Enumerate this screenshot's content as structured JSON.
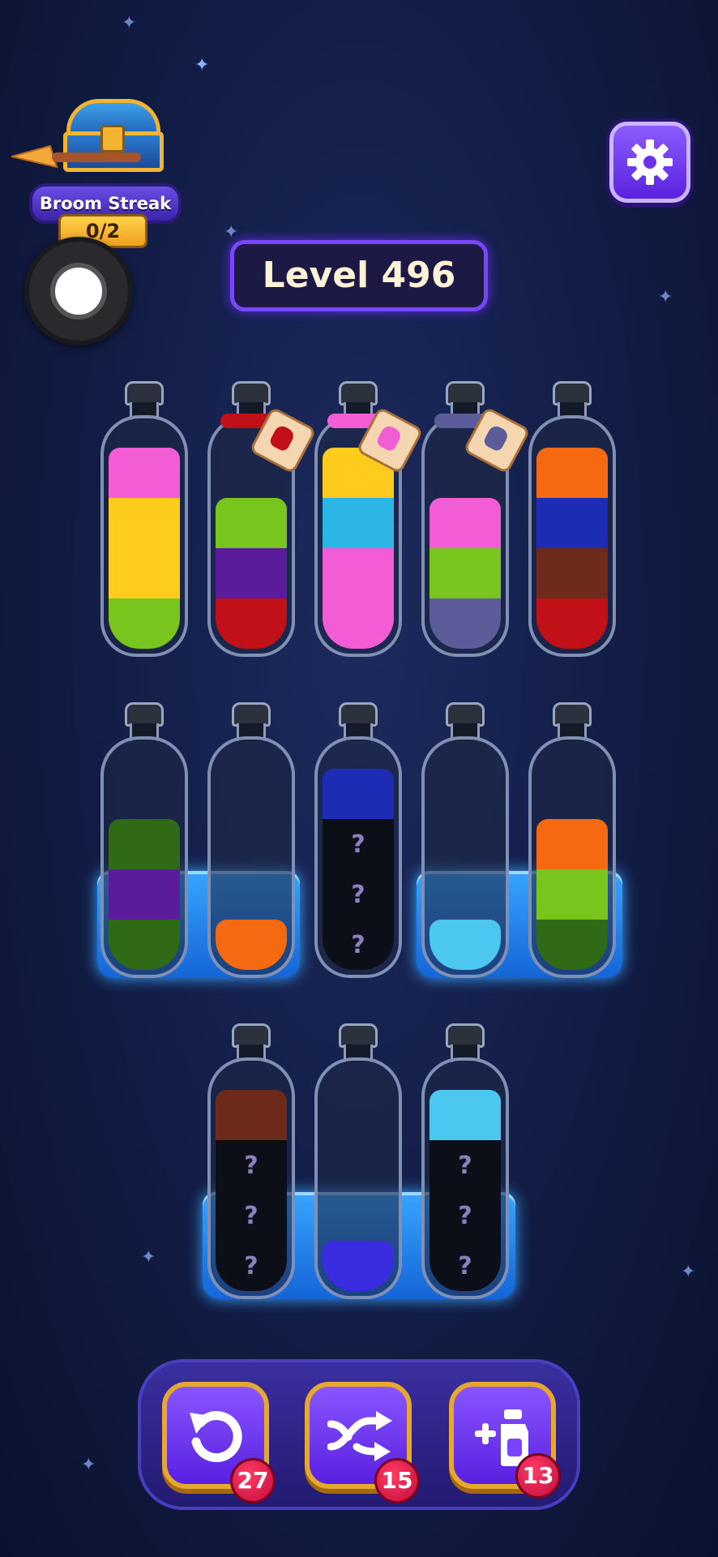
{
  "streak": {
    "label": "Broom Streak",
    "count": "0/2"
  },
  "level": {
    "label": "Level 496"
  },
  "icons": {
    "settings": "gear-icon",
    "undo": "undo-icon",
    "shuffle": "shuffle-icon",
    "add_bottle": "add-bottle-icon",
    "record": "record-icon",
    "chest": "treasure-chest-icon"
  },
  "colors": {
    "pink": "#f25dd6",
    "yellow": "#ffcc1e",
    "green": "#78c51e",
    "purple": "#5a1c9a",
    "red": "#c21018",
    "cyan": "#2bb6e6",
    "slate": "#5c5c9a",
    "orange": "#f56a10",
    "blue": "#1c2cb4",
    "brown": "#6e2a1a",
    "darkgreen": "#2f6a16",
    "skyblue": "#4cc7ef",
    "hidden": "#0d0f18",
    "royal": "#3a2ce0",
    "ice": "#2d8fff",
    "button": "#7f44ff",
    "badge": "#e81b4d",
    "gold": "#e8a82c"
  },
  "hidden_mark": "?",
  "tools": [
    {
      "name": "undo",
      "count": "27"
    },
    {
      "name": "shuffle",
      "count": "15"
    },
    {
      "name": "add-bottle",
      "count": "13"
    }
  ],
  "bottles": {
    "row1": [
      {
        "layers": [
          "green",
          "yellow",
          "yellow",
          "pink"
        ]
      },
      {
        "layers": [
          "red",
          "purple",
          "green"
        ],
        "locked": "red"
      },
      {
        "layers": [
          "pink",
          "pink",
          "cyan",
          "yellow"
        ],
        "locked": "pink"
      },
      {
        "layers": [
          "slate",
          "green",
          "pink"
        ],
        "locked": "slate"
      },
      {
        "layers": [
          "red",
          "brown",
          "blue",
          "orange"
        ]
      }
    ],
    "row2": [
      {
        "layers": [
          "darkgreen",
          "purple",
          "darkgreen"
        ],
        "frozen": true
      },
      {
        "layers": [
          "orange"
        ],
        "frozen": true
      },
      {
        "layers": [
          "hidden",
          "hidden",
          "hidden",
          "blue"
        ]
      },
      {
        "layers": [
          "skyblue"
        ],
        "frozen": true
      },
      {
        "layers": [
          "darkgreen",
          "green",
          "orange"
        ],
        "frozen": true
      }
    ],
    "row3": [
      {
        "layers": [
          "hidden",
          "hidden",
          "hidden",
          "brown"
        ],
        "frozen": true
      },
      {
        "layers": [
          "royal"
        ],
        "frozen": true
      },
      {
        "layers": [
          "hidden",
          "hidden",
          "hidden",
          "skyblue"
        ],
        "frozen": true
      }
    ]
  }
}
